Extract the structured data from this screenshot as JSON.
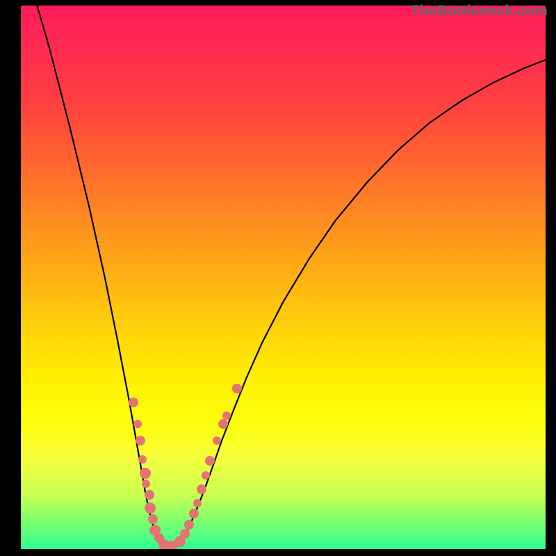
{
  "watermark": "TheBottleneck.com",
  "chart_data": {
    "type": "line",
    "title": "",
    "xlabel": "",
    "ylabel": "",
    "xlim": [
      0,
      100
    ],
    "ylim": [
      0,
      100
    ],
    "note": "V-shaped bottleneck curve on rainbow gradient. Values are screen-space positions (0..1 of plot area, y=0 top).",
    "series": [
      {
        "name": "bottleneck-curve",
        "points_plotspace": [
          [
            0.016,
            -0.05
          ],
          [
            0.055,
            0.08
          ],
          [
            0.095,
            0.23
          ],
          [
            0.13,
            0.37
          ],
          [
            0.16,
            0.5
          ],
          [
            0.185,
            0.62
          ],
          [
            0.205,
            0.72
          ],
          [
            0.218,
            0.79
          ],
          [
            0.229,
            0.85
          ],
          [
            0.238,
            0.9
          ],
          [
            0.246,
            0.935
          ],
          [
            0.253,
            0.96
          ],
          [
            0.262,
            0.98
          ],
          [
            0.272,
            0.992
          ],
          [
            0.283,
            0.997
          ],
          [
            0.296,
            0.992
          ],
          [
            0.308,
            0.98
          ],
          [
            0.318,
            0.965
          ],
          [
            0.327,
            0.945
          ],
          [
            0.338,
            0.92
          ],
          [
            0.35,
            0.89
          ],
          [
            0.365,
            0.85
          ],
          [
            0.383,
            0.8
          ],
          [
            0.405,
            0.745
          ],
          [
            0.43,
            0.685
          ],
          [
            0.46,
            0.62
          ],
          [
            0.5,
            0.545
          ],
          [
            0.55,
            0.465
          ],
          [
            0.6,
            0.395
          ],
          [
            0.66,
            0.325
          ],
          [
            0.72,
            0.265
          ],
          [
            0.78,
            0.215
          ],
          [
            0.84,
            0.175
          ],
          [
            0.9,
            0.142
          ],
          [
            0.96,
            0.115
          ],
          [
            1.0,
            0.1
          ]
        ]
      }
    ],
    "data_points_plotspace": [
      {
        "x": 0.215,
        "y": 0.73,
        "size": "m"
      },
      {
        "x": 0.223,
        "y": 0.77,
        "size": "s"
      },
      {
        "x": 0.228,
        "y": 0.8,
        "size": "m"
      },
      {
        "x": 0.232,
        "y": 0.835,
        "size": "s"
      },
      {
        "x": 0.237,
        "y": 0.86,
        "size": "l"
      },
      {
        "x": 0.239,
        "y": 0.88,
        "size": "s"
      },
      {
        "x": 0.245,
        "y": 0.9,
        "size": "m"
      },
      {
        "x": 0.247,
        "y": 0.925,
        "size": "l"
      },
      {
        "x": 0.252,
        "y": 0.945,
        "size": "m"
      },
      {
        "x": 0.255,
        "y": 0.965,
        "size": "l"
      },
      {
        "x": 0.263,
        "y": 0.98,
        "size": "m"
      },
      {
        "x": 0.273,
        "y": 0.992,
        "size": "l"
      },
      {
        "x": 0.288,
        "y": 0.995,
        "size": "l"
      },
      {
        "x": 0.303,
        "y": 0.986,
        "size": "l"
      },
      {
        "x": 0.313,
        "y": 0.972,
        "size": "m"
      },
      {
        "x": 0.32,
        "y": 0.955,
        "size": "m"
      },
      {
        "x": 0.33,
        "y": 0.935,
        "size": "m"
      },
      {
        "x": 0.336,
        "y": 0.915,
        "size": "s"
      },
      {
        "x": 0.345,
        "y": 0.89,
        "size": "m"
      },
      {
        "x": 0.352,
        "y": 0.865,
        "size": "s"
      },
      {
        "x": 0.36,
        "y": 0.838,
        "size": "m"
      },
      {
        "x": 0.374,
        "y": 0.8,
        "size": "s"
      },
      {
        "x": 0.385,
        "y": 0.77,
        "size": "m"
      },
      {
        "x": 0.392,
        "y": 0.755,
        "size": "s"
      },
      {
        "x": 0.412,
        "y": 0.705,
        "size": "m"
      }
    ]
  }
}
